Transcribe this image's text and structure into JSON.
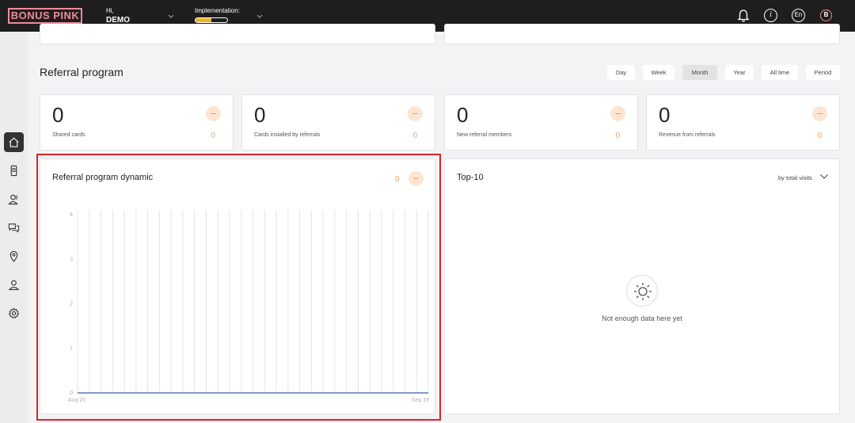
{
  "header": {
    "logo": "BONUS PINK",
    "greeting": "Hi,",
    "user": "DEMO",
    "implementation_label": "Implementation:",
    "implementation_progress": 0.5,
    "lang": "En",
    "avatar_letter": "B"
  },
  "sidebar": {
    "items": [
      {
        "name": "home-icon",
        "active": true
      },
      {
        "name": "phone-card-icon",
        "active": false
      },
      {
        "name": "users-icon",
        "active": false
      },
      {
        "name": "chat-icon",
        "active": false
      },
      {
        "name": "location-pin-icon",
        "active": false
      },
      {
        "name": "user-icon",
        "active": false
      },
      {
        "name": "gear-icon",
        "active": false
      }
    ]
  },
  "section": {
    "title": "Referral program",
    "periods": [
      "Day",
      "Week",
      "Month",
      "Year",
      "All time",
      "Period"
    ],
    "active_period": "Month"
  },
  "stats": [
    {
      "value": "0",
      "label": "Shared cards",
      "change": "0"
    },
    {
      "value": "0",
      "label": "Cards installed by referrals",
      "change": "0"
    },
    {
      "value": "0",
      "label": "New referral members",
      "change": "0"
    },
    {
      "value": "0",
      "label": "Revenue from referrals",
      "change": "0"
    }
  ],
  "dynamic": {
    "title": "Referral program dynamic",
    "value": "0"
  },
  "chart_data": {
    "type": "line",
    "x_start_label": "Aug 20",
    "x_end_label": "Sep 19",
    "y_ticks": [
      0,
      1,
      2,
      3,
      4
    ],
    "ylim": [
      0,
      4
    ],
    "series": [
      {
        "values": [
          0,
          0,
          0,
          0,
          0,
          0,
          0,
          0,
          0,
          0,
          0,
          0,
          0,
          0,
          0,
          0,
          0,
          0,
          0,
          0,
          0,
          0,
          0,
          0,
          0,
          0,
          0,
          0,
          0,
          0,
          0
        ]
      }
    ],
    "grid": true,
    "colors": {
      "line": "#3b5ea8",
      "grid": "#e4e4e8"
    }
  },
  "top10": {
    "title": "Top-10",
    "sort_label": "by total visits",
    "empty_text": "Not enough data here yet"
  },
  "colors": {
    "accent": "#f08a9a",
    "orange": "#e9a36b",
    "highlight": "#d8232a"
  }
}
